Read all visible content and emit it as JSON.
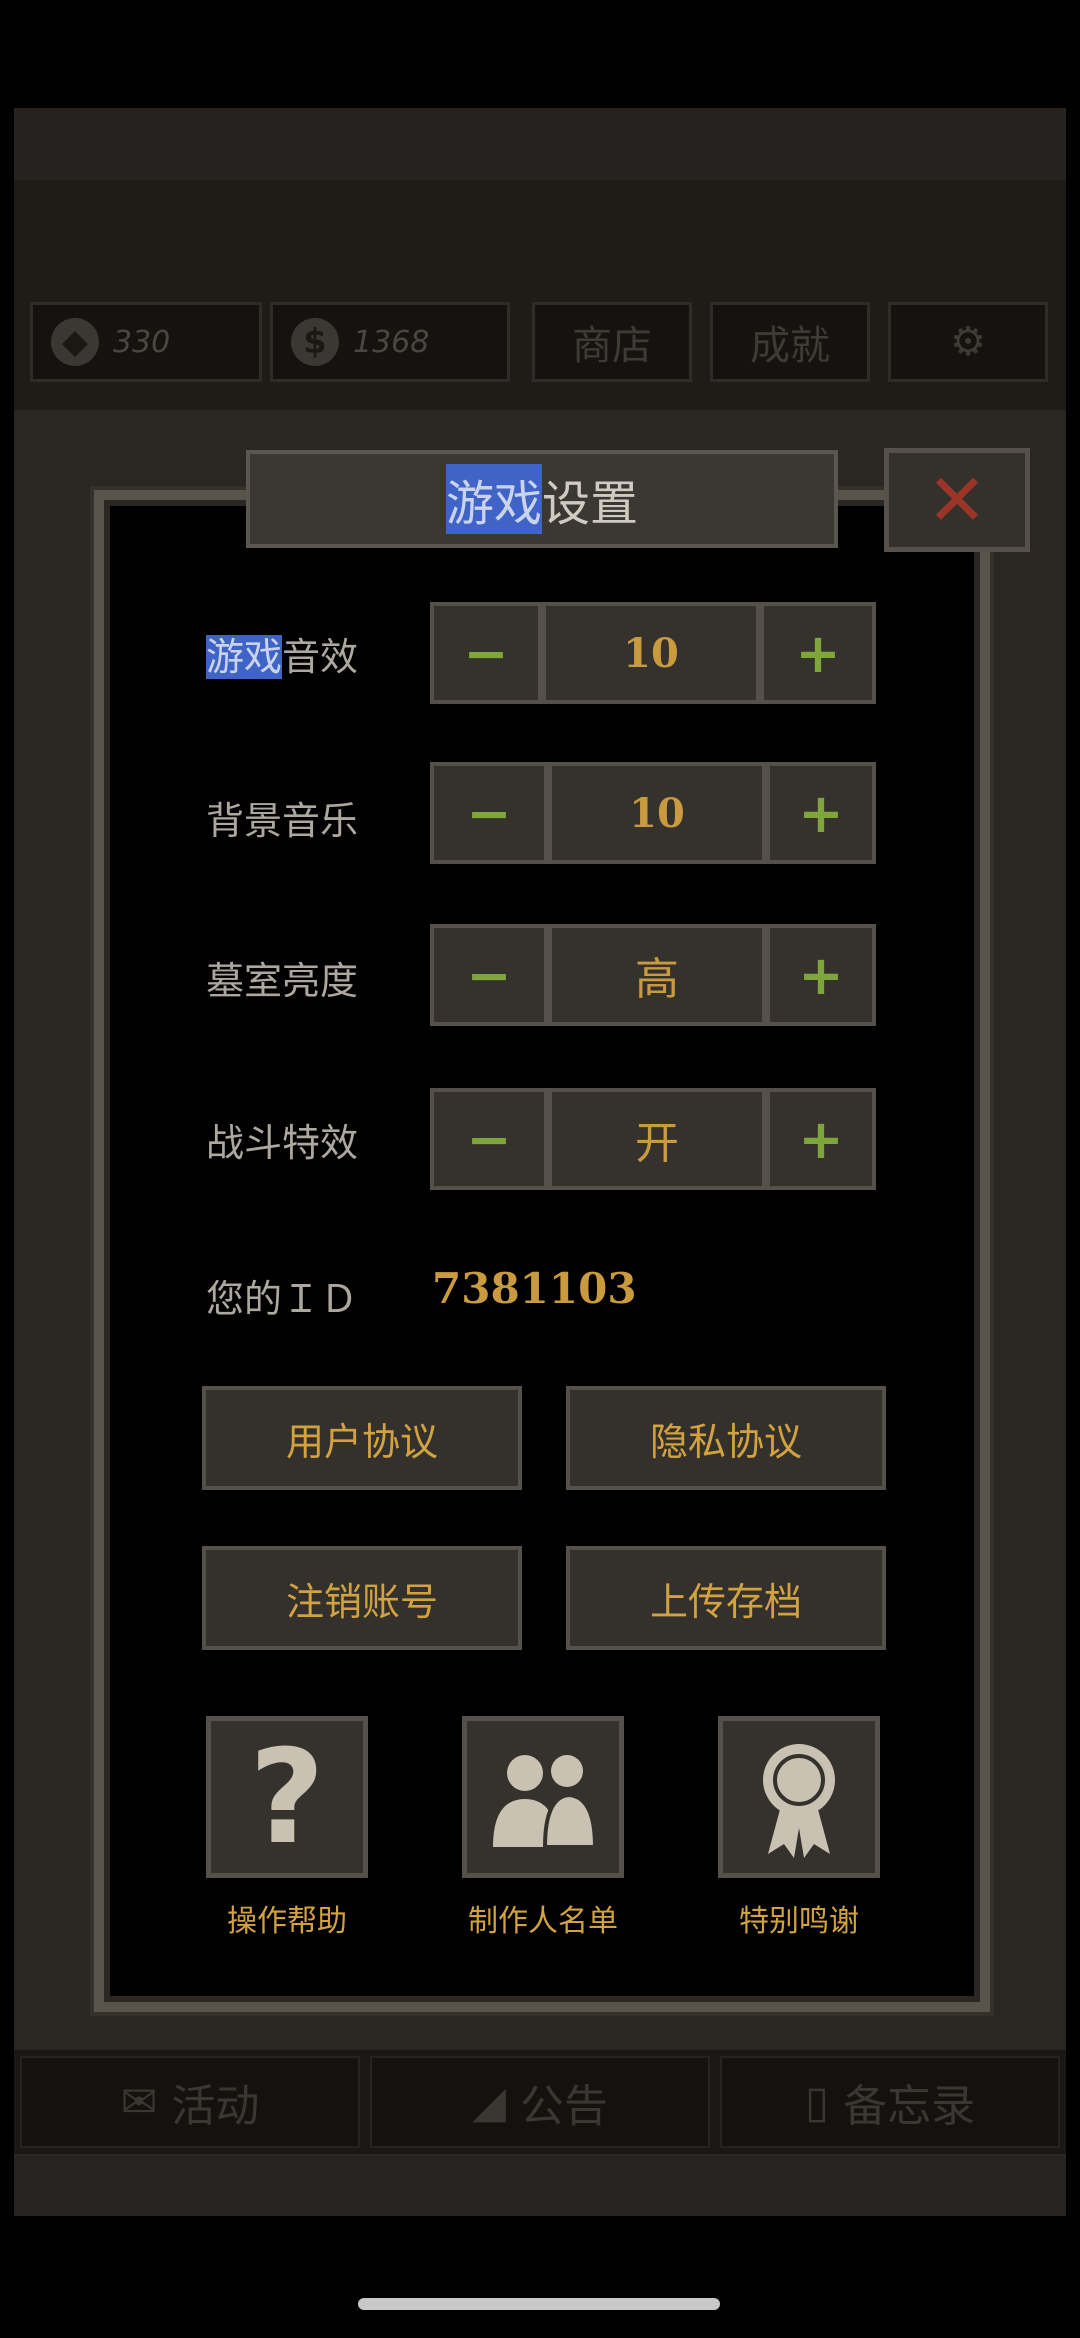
{
  "topbar": {
    "gems": "330",
    "coins": "1368",
    "shop_label": "商店",
    "achievements_label": "成就"
  },
  "bottombar": {
    "activity_label": "活动",
    "notice_label": "公告",
    "memo_label": "备忘录"
  },
  "dialog": {
    "title_highlight": "游戏",
    "title_rest": "设置",
    "close_symbol": "✕",
    "rows": [
      {
        "label_highlight": "游戏",
        "label_rest": "音效",
        "value": "10"
      },
      {
        "label_highlight": "",
        "label_rest": "背景音乐",
        "value": "10"
      },
      {
        "label_highlight": "",
        "label_rest": "墓室亮度",
        "value": "高"
      },
      {
        "label_highlight": "",
        "label_rest": "战斗特效",
        "value": "开"
      }
    ],
    "minus_symbol": "−",
    "plus_symbol": "+",
    "id_label": "您的ＩＤ",
    "id_value": "7381103",
    "buttons": {
      "user_agreement": "用户协议",
      "privacy_agreement": "隐私协议",
      "delete_account": "注销账号",
      "upload_save": "上传存档"
    },
    "icon_buttons": {
      "help": "操作帮助",
      "credits": "制作人名单",
      "thanks": "特别鸣谢"
    }
  },
  "colors": {
    "accent_gold": "#d1a23f",
    "plus_minus_green": "#7fa63a",
    "close_red": "#9b3527",
    "selection_blue": "#3f63c7"
  }
}
